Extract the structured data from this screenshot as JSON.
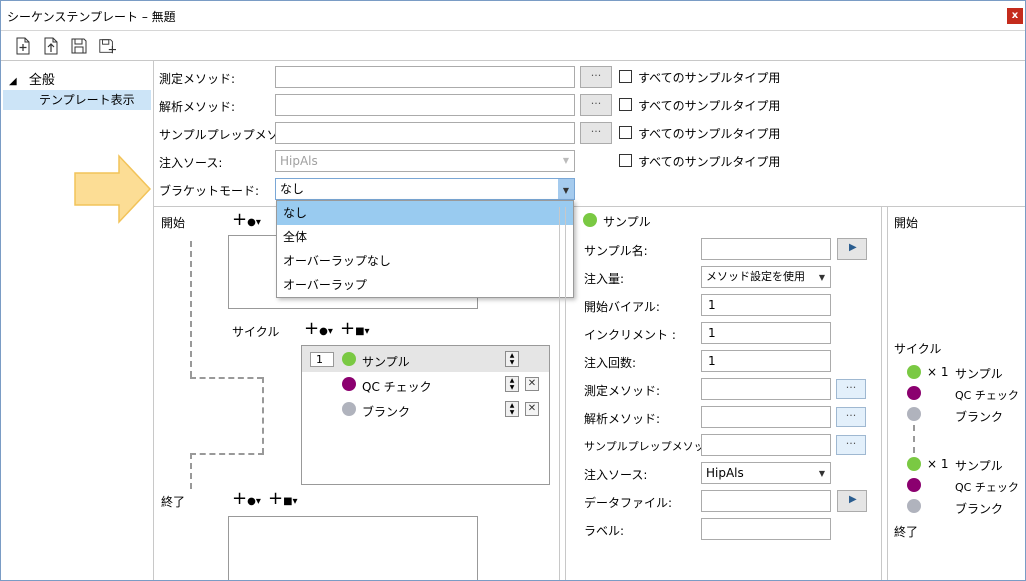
{
  "window": {
    "title": "シーケンステンプレート – 無題",
    "close_label": "x"
  },
  "sidebar": {
    "root_label": "全般",
    "selected_child": "テンプレート表示"
  },
  "form": {
    "measure_method_label": "測定メソッド:",
    "analysis_method_label": "解析メソッド:",
    "sample_prep_label": "サンプルプレップメソッド:",
    "injection_source_label": "注入ソース:",
    "injection_source_value": "HipAls",
    "bracket_mode_label": "ブラケットモード:",
    "bracket_mode_value": "なし",
    "all_sample_types": "すべてのサンプルタイプ用",
    "dots": "···"
  },
  "dropdown": {
    "options": [
      "なし",
      "全体",
      "オーバーラップなし",
      "オーバーラップ"
    ]
  },
  "sequence": {
    "start_label": "開始",
    "cycle_label": "サイクル",
    "end_label": "終了",
    "cycle_count": "1",
    "items": [
      {
        "label": "サンプル",
        "color": "#7ac943"
      },
      {
        "label": "QC チェック",
        "color": "#8b006f"
      },
      {
        "label": "ブランク",
        "color": "#b0b3bd"
      }
    ]
  },
  "sample_panel": {
    "header": "サンプル",
    "sample_name_label": "サンプル名:",
    "injection_volume_label": "注入量:",
    "injection_volume_value": "メソッド設定を使用",
    "start_vial_label": "開始バイアル:",
    "start_vial_value": "1",
    "increment_label": "インクリメント :",
    "increment_value": "1",
    "injection_count_label": "注入回数:",
    "injection_count_value": "1",
    "measure_method_label": "測定メソッド:",
    "analysis_method_label": "解析メソッド:",
    "sample_prep_label": "サンプルプレップメソッド:",
    "injection_source_label": "注入ソース:",
    "injection_source_value": "HipAls",
    "data_file_label": "データファイル:",
    "label_label": "ラベル:"
  },
  "preview": {
    "start_label": "開始",
    "cycle_label": "サイクル",
    "end_label": "終了",
    "multiplier": "× 1",
    "sample": "サンプル",
    "qc": "QC チェック",
    "blank": "ブランク"
  }
}
